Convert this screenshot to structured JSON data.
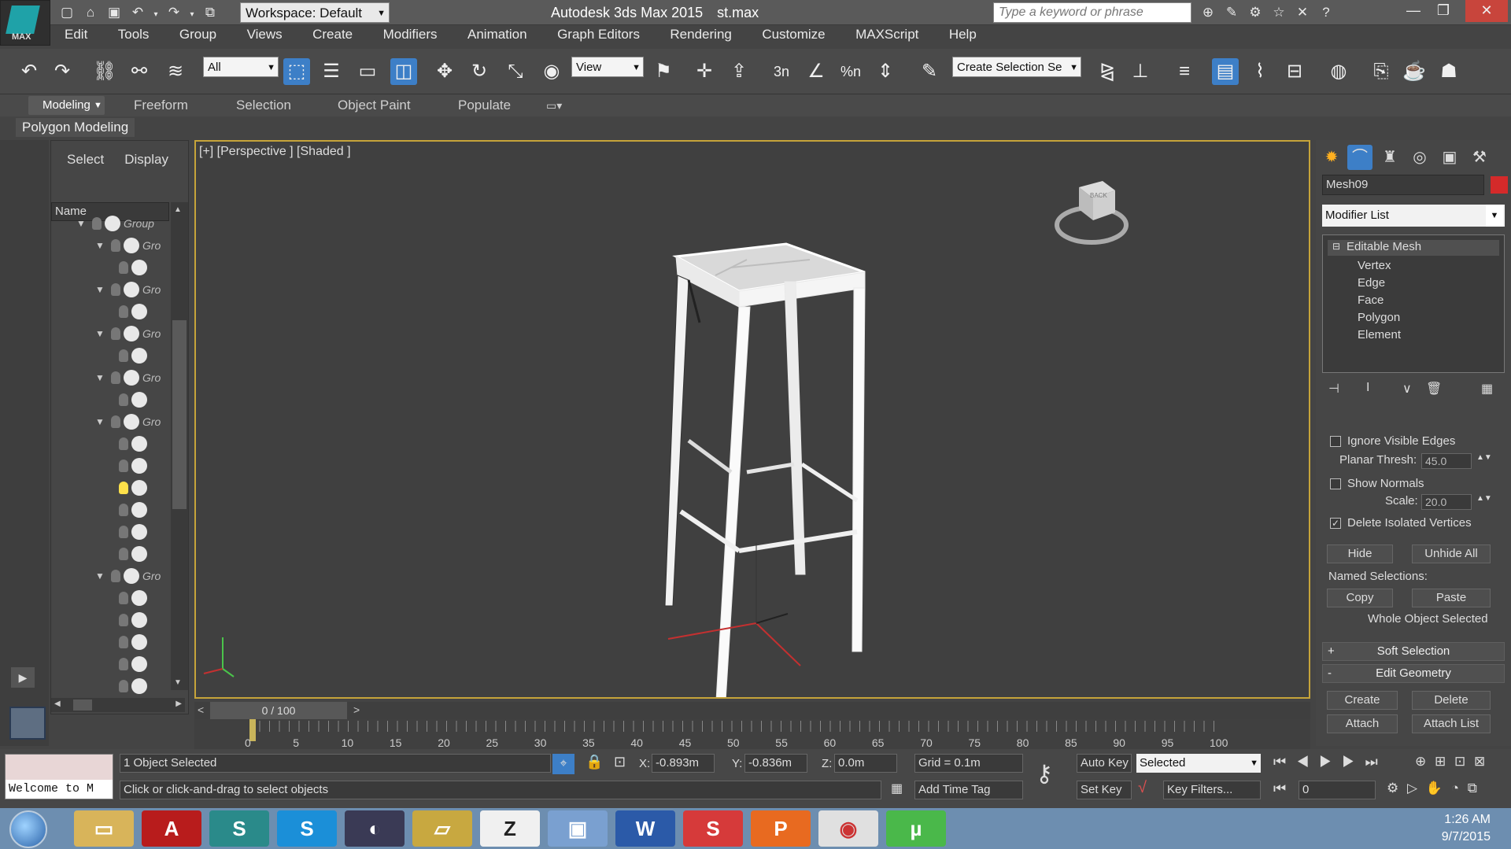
{
  "app": {
    "title": "Autodesk 3ds Max  2015",
    "file": "st.max",
    "logo": "MAX",
    "workspace": "Workspace: Default",
    "search_placeholder": "Type a keyword or phrase"
  },
  "menus": [
    "Edit",
    "Tools",
    "Group",
    "Views",
    "Create",
    "Modifiers",
    "Animation",
    "Graph Editors",
    "Rendering",
    "Customize",
    "MAXScript",
    "Help"
  ],
  "toolbar": {
    "filter": "All",
    "refcoord": "View",
    "selection_set": "Create Selection Se",
    "snap_labels": [
      "3n",
      "%n"
    ]
  },
  "ribbon": {
    "tabs": [
      "Modeling",
      "Freeform",
      "Selection",
      "Object Paint",
      "Populate"
    ],
    "panel": "Polygon Modeling"
  },
  "scene_explorer": {
    "tabs": [
      "Select",
      "Display"
    ],
    "column": "Name",
    "group_label": "Group",
    "group_label_short": "Gro"
  },
  "viewport": {
    "label": "[+] [Perspective ] [Shaded ]",
    "viewcube_label": "BACK"
  },
  "command_panel": {
    "object_name": "Mesh09",
    "object_color": "#d42a2a",
    "modifier_list": "Modifier List",
    "stack": [
      "Editable Mesh",
      "Vertex",
      "Edge",
      "Face",
      "Polygon",
      "Element"
    ],
    "ignore_visible_edges": "Ignore Visible Edges",
    "planar_thresh_label": "Planar Thresh:",
    "planar_thresh": "45.0",
    "show_normals": "Show Normals",
    "scale_label": "Scale:",
    "scale": "20.0",
    "delete_isolated": "Delete Isolated Vertices",
    "hide": "Hide",
    "unhide_all": "Unhide All",
    "named_selections": "Named Selections:",
    "copy": "Copy",
    "paste": "Paste",
    "whole_object": "Whole Object Selected",
    "soft_selection": "Soft Selection",
    "edit_geometry": "Edit Geometry",
    "create": "Create",
    "delete": "Delete",
    "attach": "Attach",
    "attach_list": "Attach List"
  },
  "timeline": {
    "slider": "0 / 100",
    "ticks": [
      "0",
      "5",
      "10",
      "15",
      "20",
      "25",
      "30",
      "35",
      "40",
      "45",
      "50",
      "55",
      "60",
      "65",
      "70",
      "75",
      "80",
      "85",
      "90",
      "95",
      "100"
    ]
  },
  "status": {
    "welcome": "Welcome to M",
    "selected": "1 Object Selected",
    "prompt": "Click or click-and-drag to select objects",
    "x_label": "X:",
    "x": "-0.893m",
    "y_label": "Y:",
    "y": "-0.836m",
    "z_label": "Z:",
    "z": "0.0m",
    "grid": "Grid = 0.1m",
    "add_time_tag": "Add Time Tag",
    "auto_key": "Auto Key",
    "key_mode": "Selected",
    "set_key": "Set Key",
    "key_filters": "Key Filters...",
    "frame": "0"
  },
  "taskbar": {
    "time": "1:26 AM",
    "date": "9/7/2015"
  }
}
